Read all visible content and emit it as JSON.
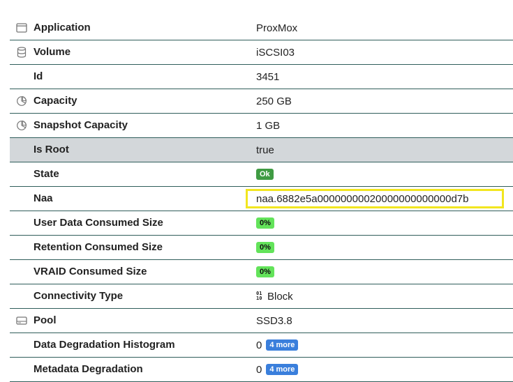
{
  "rows": [
    {
      "key": "Application",
      "value": "ProxMox",
      "icon": "window-icon"
    },
    {
      "key": "Volume",
      "value": "iSCSI03",
      "icon": "database-icon"
    },
    {
      "key": "Id",
      "value": "3451"
    },
    {
      "key": "Capacity",
      "value": "250 GB",
      "icon": "pie-chart-icon"
    },
    {
      "key": "Snapshot Capacity",
      "value": "1 GB",
      "icon": "pie-chart-icon"
    },
    {
      "key": "Is Root",
      "value": "true"
    },
    {
      "key": "State",
      "value": "Ok"
    },
    {
      "key": "Naa",
      "value": "naa.6882e5a00000000020000000000000d7b"
    },
    {
      "key": "User Data Consumed Size",
      "value": "0%"
    },
    {
      "key": "Retention Consumed Size",
      "value": "0%"
    },
    {
      "key": "VRAID Consumed Size",
      "value": "0%"
    },
    {
      "key": "Connectivity Type",
      "value": "Block",
      "icon_text": "01\n10"
    },
    {
      "key": "Pool",
      "value": "SSD3.8",
      "icon": "hard-drive-icon"
    },
    {
      "key": "Data Degradation Histogram",
      "value": "0",
      "more": "4 more"
    },
    {
      "key": "Metadata Degradation",
      "value": "0",
      "more": "4 more"
    }
  ],
  "colors": {
    "row_border": "#2f5d5a",
    "highlight_row": "#d3d7da",
    "ok_badge": "#3f9b43",
    "percent_badge": "#63e35a",
    "more_badge": "#3a7fdc",
    "focus_outline": "#f2e61f"
  }
}
